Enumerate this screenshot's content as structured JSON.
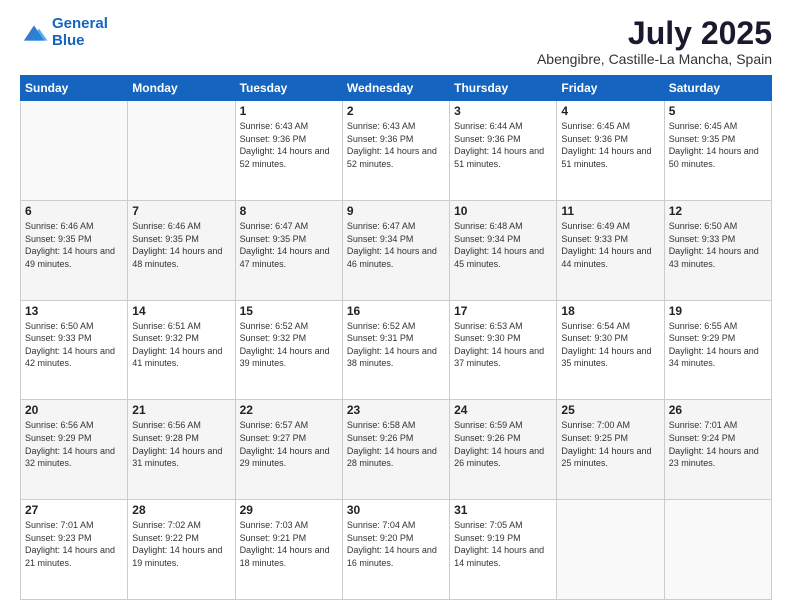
{
  "logo": {
    "line1": "General",
    "line2": "Blue"
  },
  "header": {
    "month": "July 2025",
    "location": "Abengibre, Castille-La Mancha, Spain"
  },
  "weekdays": [
    "Sunday",
    "Monday",
    "Tuesday",
    "Wednesday",
    "Thursday",
    "Friday",
    "Saturday"
  ],
  "weeks": [
    [
      {
        "day": null
      },
      {
        "day": null
      },
      {
        "day": "1",
        "sunrise": "6:43 AM",
        "sunset": "9:36 PM",
        "daylight": "14 hours and 52 minutes."
      },
      {
        "day": "2",
        "sunrise": "6:43 AM",
        "sunset": "9:36 PM",
        "daylight": "14 hours and 52 minutes."
      },
      {
        "day": "3",
        "sunrise": "6:44 AM",
        "sunset": "9:36 PM",
        "daylight": "14 hours and 51 minutes."
      },
      {
        "day": "4",
        "sunrise": "6:45 AM",
        "sunset": "9:36 PM",
        "daylight": "14 hours and 51 minutes."
      },
      {
        "day": "5",
        "sunrise": "6:45 AM",
        "sunset": "9:35 PM",
        "daylight": "14 hours and 50 minutes."
      }
    ],
    [
      {
        "day": "6",
        "sunrise": "6:46 AM",
        "sunset": "9:35 PM",
        "daylight": "14 hours and 49 minutes."
      },
      {
        "day": "7",
        "sunrise": "6:46 AM",
        "sunset": "9:35 PM",
        "daylight": "14 hours and 48 minutes."
      },
      {
        "day": "8",
        "sunrise": "6:47 AM",
        "sunset": "9:35 PM",
        "daylight": "14 hours and 47 minutes."
      },
      {
        "day": "9",
        "sunrise": "6:47 AM",
        "sunset": "9:34 PM",
        "daylight": "14 hours and 46 minutes."
      },
      {
        "day": "10",
        "sunrise": "6:48 AM",
        "sunset": "9:34 PM",
        "daylight": "14 hours and 45 minutes."
      },
      {
        "day": "11",
        "sunrise": "6:49 AM",
        "sunset": "9:33 PM",
        "daylight": "14 hours and 44 minutes."
      },
      {
        "day": "12",
        "sunrise": "6:50 AM",
        "sunset": "9:33 PM",
        "daylight": "14 hours and 43 minutes."
      }
    ],
    [
      {
        "day": "13",
        "sunrise": "6:50 AM",
        "sunset": "9:33 PM",
        "daylight": "14 hours and 42 minutes."
      },
      {
        "day": "14",
        "sunrise": "6:51 AM",
        "sunset": "9:32 PM",
        "daylight": "14 hours and 41 minutes."
      },
      {
        "day": "15",
        "sunrise": "6:52 AM",
        "sunset": "9:32 PM",
        "daylight": "14 hours and 39 minutes."
      },
      {
        "day": "16",
        "sunrise": "6:52 AM",
        "sunset": "9:31 PM",
        "daylight": "14 hours and 38 minutes."
      },
      {
        "day": "17",
        "sunrise": "6:53 AM",
        "sunset": "9:30 PM",
        "daylight": "14 hours and 37 minutes."
      },
      {
        "day": "18",
        "sunrise": "6:54 AM",
        "sunset": "9:30 PM",
        "daylight": "14 hours and 35 minutes."
      },
      {
        "day": "19",
        "sunrise": "6:55 AM",
        "sunset": "9:29 PM",
        "daylight": "14 hours and 34 minutes."
      }
    ],
    [
      {
        "day": "20",
        "sunrise": "6:56 AM",
        "sunset": "9:29 PM",
        "daylight": "14 hours and 32 minutes."
      },
      {
        "day": "21",
        "sunrise": "6:56 AM",
        "sunset": "9:28 PM",
        "daylight": "14 hours and 31 minutes."
      },
      {
        "day": "22",
        "sunrise": "6:57 AM",
        "sunset": "9:27 PM",
        "daylight": "14 hours and 29 minutes."
      },
      {
        "day": "23",
        "sunrise": "6:58 AM",
        "sunset": "9:26 PM",
        "daylight": "14 hours and 28 minutes."
      },
      {
        "day": "24",
        "sunrise": "6:59 AM",
        "sunset": "9:26 PM",
        "daylight": "14 hours and 26 minutes."
      },
      {
        "day": "25",
        "sunrise": "7:00 AM",
        "sunset": "9:25 PM",
        "daylight": "14 hours and 25 minutes."
      },
      {
        "day": "26",
        "sunrise": "7:01 AM",
        "sunset": "9:24 PM",
        "daylight": "14 hours and 23 minutes."
      }
    ],
    [
      {
        "day": "27",
        "sunrise": "7:01 AM",
        "sunset": "9:23 PM",
        "daylight": "14 hours and 21 minutes."
      },
      {
        "day": "28",
        "sunrise": "7:02 AM",
        "sunset": "9:22 PM",
        "daylight": "14 hours and 19 minutes."
      },
      {
        "day": "29",
        "sunrise": "7:03 AM",
        "sunset": "9:21 PM",
        "daylight": "14 hours and 18 minutes."
      },
      {
        "day": "30",
        "sunrise": "7:04 AM",
        "sunset": "9:20 PM",
        "daylight": "14 hours and 16 minutes."
      },
      {
        "day": "31",
        "sunrise": "7:05 AM",
        "sunset": "9:19 PM",
        "daylight": "14 hours and 14 minutes."
      },
      {
        "day": null
      },
      {
        "day": null
      }
    ]
  ]
}
